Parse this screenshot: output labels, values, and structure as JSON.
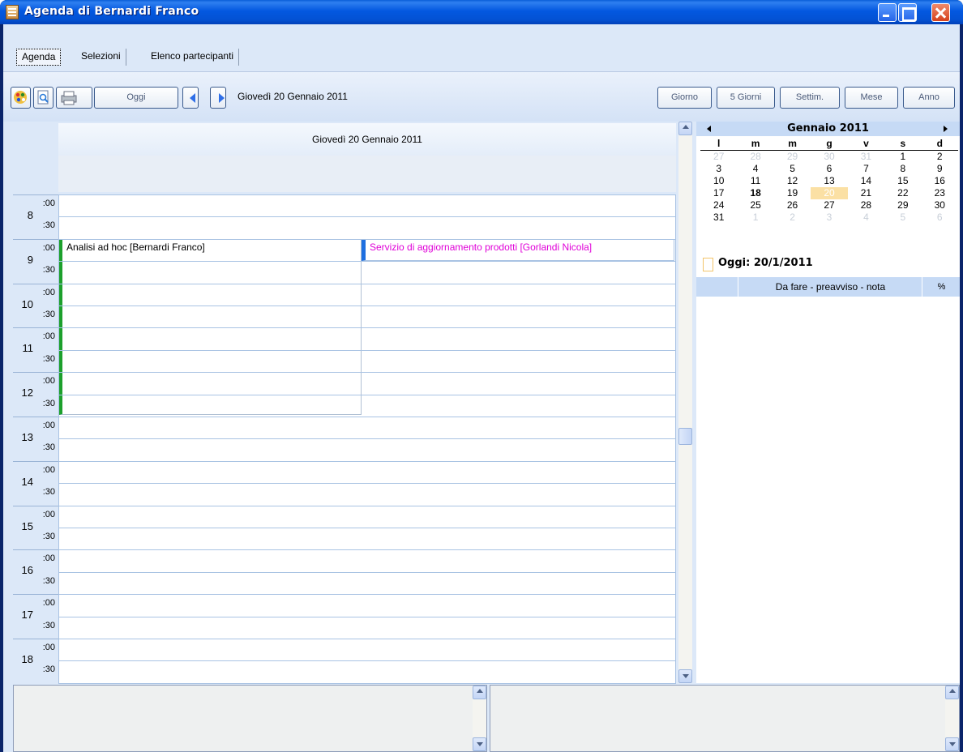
{
  "window": {
    "title": "Agenda di Bernardi Franco"
  },
  "tabs": [
    {
      "label": "Agenda"
    },
    {
      "label": "Selezioni"
    },
    {
      "label": "Elenco partecipanti"
    }
  ],
  "toolbar": {
    "today_label": "Oggi",
    "current_date": "Giovedì 20 Gennaio 2011",
    "view_buttons": [
      {
        "label": "Giorno"
      },
      {
        "label": "5 Giorni"
      },
      {
        "label": "Settim."
      },
      {
        "label": "Mese"
      },
      {
        "label": "Anno"
      }
    ]
  },
  "dayview": {
    "header": "Giovedì 20 Gennaio 2011",
    "hours": [
      "8",
      "9",
      "10",
      "11",
      "12",
      "13",
      "14",
      "15",
      "16",
      "17",
      "18"
    ],
    "minutes": [
      ":00",
      ":30"
    ],
    "events": [
      {
        "title": "Analisi ad hoc  [Bernardi Franco]",
        "start": "9:00",
        "end": "13:00",
        "color": "#1ca02c"
      },
      {
        "title": "Servizio di aggiornamento prodotti  [Gorlandi Nicola]",
        "start": "9:00",
        "end": "9:30",
        "color": "#1e6fe0",
        "text_color": "#e000d8"
      }
    ]
  },
  "calendar": {
    "month": "Gennaio 2011",
    "weekdays": [
      "l",
      "m",
      "m",
      "g",
      "v",
      "s",
      "d"
    ],
    "weeks": [
      [
        "27",
        "28",
        "29",
        "30",
        "31",
        "1",
        "2"
      ],
      [
        "3",
        "4",
        "5",
        "6",
        "7",
        "8",
        "9"
      ],
      [
        "10",
        "11",
        "12",
        "13",
        "14",
        "15",
        "16"
      ],
      [
        "17",
        "18",
        "19",
        "20",
        "21",
        "22",
        "23"
      ],
      [
        "24",
        "25",
        "26",
        "27",
        "28",
        "29",
        "30"
      ],
      [
        "31",
        "1",
        "2",
        "3",
        "4",
        "5",
        "6"
      ]
    ],
    "selected_day": "20",
    "bold_day": "18",
    "today_label": "Oggi: 20/1/2011"
  },
  "todo": {
    "columns": [
      "",
      "Da fare - preavviso - nota",
      "%"
    ]
  }
}
